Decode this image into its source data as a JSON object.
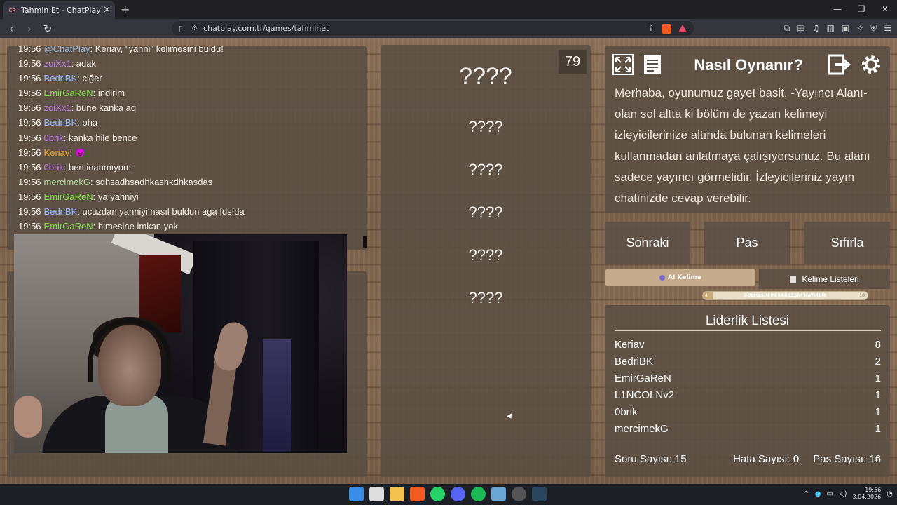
{
  "browser": {
    "tab_title": "Tahmin Et - ChatPlay",
    "tab_favicon_text": "CP",
    "url": "chatplay.com.tr/games/tahminet"
  },
  "chat": {
    "messages": [
      {
        "time": "19:56",
        "user": "@ChatPlay",
        "user_color": "#9ab7e0",
        "text": ": Keriav, \"yahni\" kelimesini buldu!"
      },
      {
        "time": "19:56",
        "user": "zoiXx1",
        "user_color": "#b77be8",
        "text": ": adak"
      },
      {
        "time": "19:56",
        "user": "BedriBK",
        "user_color": "#8fb7ff",
        "text": ": ciğer"
      },
      {
        "time": "19:56",
        "user": "EmirGaReN",
        "user_color": "#7ee04a",
        "text": ": indirim"
      },
      {
        "time": "19:56",
        "user": "zoiXx1",
        "user_color": "#b77be8",
        "text": ": bune kanka aq"
      },
      {
        "time": "19:56",
        "user": "BedriBK",
        "user_color": "#8fb7ff",
        "text": ": oha"
      },
      {
        "time": "19:56",
        "user": "0brik",
        "user_color": "#c080f0",
        "text": ": kanka hile bence"
      },
      {
        "time": "19:56",
        "user": "Keriav",
        "user_color": "#f0a030",
        "text": ": 😈"
      },
      {
        "time": "19:56",
        "user": "0brik",
        "user_color": "#c080f0",
        "text": ": ben inanmıyom"
      },
      {
        "time": "19:56",
        "user": "mercimekG",
        "user_color": "#b0e0a0",
        "text": ": sdhsadhsadhkashkdhkasdas"
      },
      {
        "time": "19:56",
        "user": "EmirGaReN",
        "user_color": "#7ee04a",
        "text": ": ya yahniyi"
      },
      {
        "time": "19:56",
        "user": "BedriBK",
        "user_color": "#8fb7ff",
        "text": ": ucuzdan yahniyi nasıl buldun aga fdsfda"
      },
      {
        "time": "19:56",
        "user": "EmirGaReN",
        "user_color": "#7ee04a",
        "text": ": bimesine imkan yok"
      }
    ]
  },
  "game": {
    "counter": "79",
    "main_word": "????",
    "hidden_words": [
      "????",
      "????",
      "????",
      "????",
      "????"
    ]
  },
  "info": {
    "title": "Nasıl Oynanır?",
    "text": "Merhaba, oyunumuz gayet basit. -Yayıncı Alanı- olan sol altta ki bölüm de yazan kelimeyi izleyicilerinize altında bulunan kelimeleri kullanmadan anlatmaya çalışıyorsunuz. Bu alanı sadece yayıncı görmelidir. İzleyicileriniz yayın chatinizde cevap verebilir."
  },
  "actions": {
    "next": "Sonraki",
    "pass": "Pas",
    "reset": "Sıfırla",
    "ai_word": "AI Kelime",
    "word_lists": "Kelime Listeleri"
  },
  "slider": {
    "label": "DOLMASIN MI KARDEŞİM HAYIRDIR",
    "min": "4",
    "max": "10",
    "value": 4
  },
  "leaderboard": {
    "title": "Liderlik Listesi",
    "rows": [
      {
        "name": "Keriav",
        "score": "8"
      },
      {
        "name": "BedriBK",
        "score": "2"
      },
      {
        "name": "EmirGaReN",
        "score": "1"
      },
      {
        "name": "L1NCOLNv2",
        "score": "1"
      },
      {
        "name": "0brik",
        "score": "1"
      },
      {
        "name": "mercimekG",
        "score": "1"
      }
    ],
    "question_count": "Soru Sayısı: 15",
    "error_count": "Hata Sayısı: 0",
    "pass_count": "Pas Sayısı: 16"
  },
  "taskbar": {
    "time": "19:56",
    "date": "3.04.2026"
  }
}
